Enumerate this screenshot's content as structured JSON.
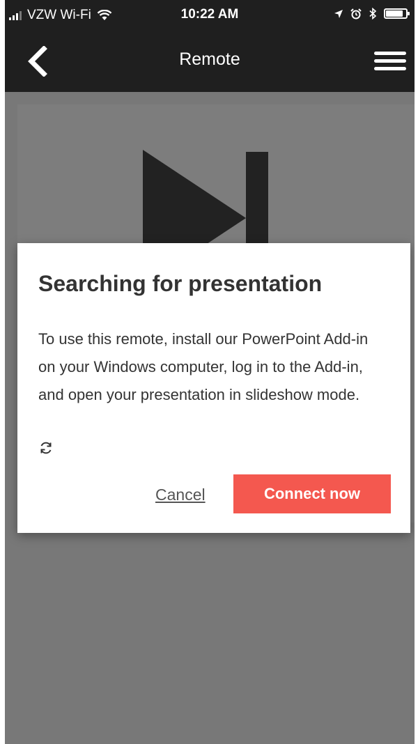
{
  "status_bar": {
    "carrier": "VZW Wi-Fi",
    "time": "10:22 AM",
    "icons": [
      "signal-icon",
      "wifi-icon",
      "location-icon",
      "alarm-icon",
      "bluetooth-icon",
      "battery-icon"
    ]
  },
  "nav": {
    "title": "Remote",
    "back_icon": "chevron-left-icon",
    "menu_icon": "hamburger-menu-icon"
  },
  "remote": {
    "icon": "next-slide-icon"
  },
  "dialog": {
    "title": "Searching for presentation",
    "body": "To use this remote, install our PowerPoint Add-in on your Windows computer, log in to the Add-in, and open your presentation in slideshow mode.",
    "spinner_icon": "refresh-spinner-icon",
    "cancel_label": "Cancel",
    "connect_label": "Connect now"
  },
  "colors": {
    "header_bg": "#1f1f1f",
    "overlay_bg": "#787878",
    "accent": "#f4584f"
  }
}
